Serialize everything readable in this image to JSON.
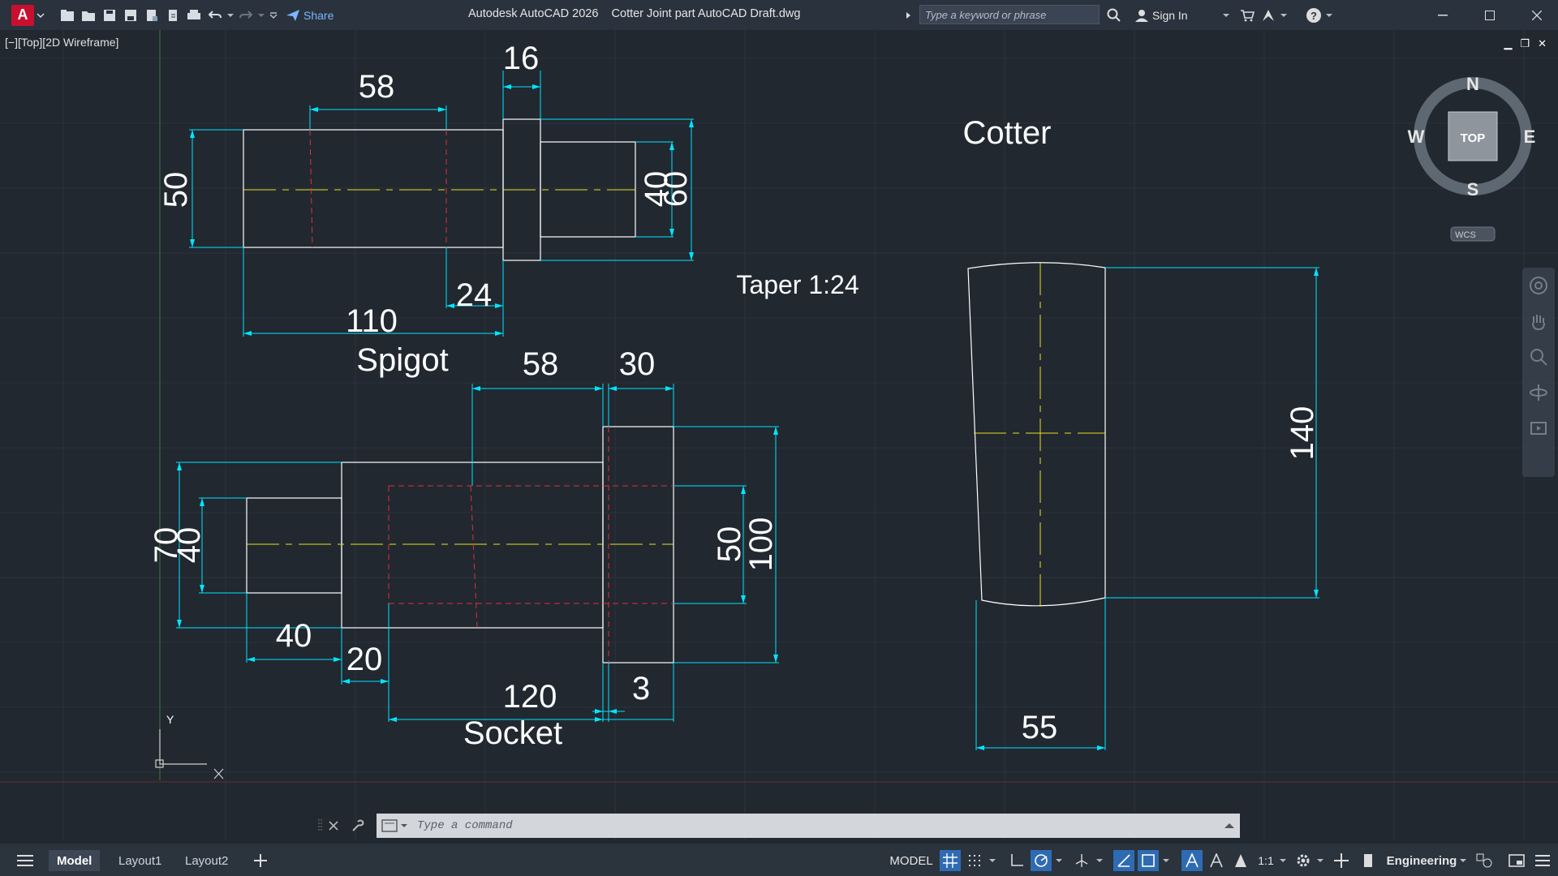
{
  "titlebar": {
    "app_logo": "A",
    "share_label": "Share",
    "document_title": "Autodesk AutoCAD 2026    Cotter Joint part AutoCAD Draft.dwg",
    "search_placeholder": "Type a keyword or phrase",
    "sign_in_label": "Sign In"
  },
  "viewport": {
    "label": "[−][Top][2D Wireframe]"
  },
  "viewcube": {
    "face": "TOP",
    "north": "N",
    "south": "S",
    "east": "E",
    "west": "W",
    "ucs_label": "WCS"
  },
  "ucs_icon": {
    "y_label": "Y",
    "x_label": "X"
  },
  "drawing": {
    "spigot": {
      "title": "Spigot",
      "dims": [
        "58",
        "16",
        "50",
        "40",
        "60",
        "24",
        "110"
      ]
    },
    "socket": {
      "title": "Socket",
      "dims": [
        "58",
        "30",
        "70",
        "40",
        "50",
        "100",
        "40",
        "20",
        "120",
        "3"
      ]
    },
    "cotter": {
      "title": "Cotter",
      "taper": "Taper 1:24",
      "dims": [
        "140",
        "55"
      ]
    }
  },
  "commandline": {
    "placeholder": "Type a command"
  },
  "statusbar": {
    "tabs": [
      "Model",
      "Layout1",
      "Layout2"
    ],
    "model_label": "MODEL",
    "scale_label": "1:1",
    "workspace_label": "Engineering"
  },
  "colors": {
    "background": "#212830",
    "dimension": "#00e5ff",
    "object": "#ffffff",
    "centerline": "#e8e021",
    "hidden": "#e0303a",
    "accent": "#2f6bb3"
  }
}
